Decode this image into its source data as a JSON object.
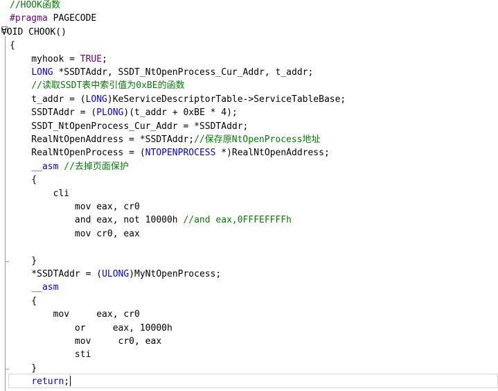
{
  "colors": {
    "comment": "#008000",
    "keyword": "#0000ff",
    "macro": "#6f008a",
    "text": "#000000",
    "background": "#ffffff"
  },
  "icons": {
    "fold": "collapse-minus-icon"
  },
  "lines": [
    [
      {
        "t": "//HOOK函数",
        "c": "comment"
      }
    ],
    [
      {
        "t": "#pragma",
        "c": "mac"
      },
      {
        "t": " PAGECODE",
        "c": "plain"
      }
    ],
    [
      {
        "t": "VOID CHOOK()",
        "c": "plain"
      }
    ],
    [
      {
        "t": "{",
        "c": "plain"
      }
    ],
    [
      {
        "t": "    myhook = ",
        "c": "plain"
      },
      {
        "t": "TRUE",
        "c": "mac"
      },
      {
        "t": ";",
        "c": "plain"
      }
    ],
    [
      {
        "t": "    ",
        "c": "plain"
      },
      {
        "t": "LONG",
        "c": "type"
      },
      {
        "t": " *SSDTAddr, SSDT_NtOpenProcess_Cur_Addr, t_addr;",
        "c": "plain"
      }
    ],
    [
      {
        "t": "    ",
        "c": "plain"
      },
      {
        "t": "//读取SSDT表中索引值为0xBE的函数",
        "c": "comment"
      }
    ],
    [
      {
        "t": "    t_addr = (",
        "c": "plain"
      },
      {
        "t": "LONG",
        "c": "type"
      },
      {
        "t": ")KeServiceDescriptorTable->ServiceTableBase;",
        "c": "plain"
      }
    ],
    [
      {
        "t": "    SSDTAddr = (",
        "c": "plain"
      },
      {
        "t": "PLONG",
        "c": "type"
      },
      {
        "t": ")(t_addr + 0xBE * 4);",
        "c": "plain"
      }
    ],
    [
      {
        "t": "    SSDT_NtOpenProcess_Cur_Addr = *SSDTAddr;",
        "c": "plain"
      }
    ],
    [
      {
        "t": "    RealNtOpenAddress = *SSDTAddr;",
        "c": "plain"
      },
      {
        "t": "//保存原NtOpenProcess地址",
        "c": "comment"
      }
    ],
    [
      {
        "t": "    RealNtOpenProcess = (",
        "c": "plain"
      },
      {
        "t": "NTOPENPROCESS",
        "c": "type"
      },
      {
        "t": " *)RealNtOpenAddress;",
        "c": "plain"
      }
    ],
    [
      {
        "t": "    ",
        "c": "plain"
      },
      {
        "t": "__asm",
        "c": "kw"
      },
      {
        "t": " ",
        "c": "plain"
      },
      {
        "t": "//去掉页面保护",
        "c": "comment"
      }
    ],
    [
      {
        "t": "    {",
        "c": "plain"
      }
    ],
    [
      {
        "t": "        cli",
        "c": "plain"
      }
    ],
    [
      {
        "t": "            mov eax, cr0",
        "c": "plain"
      }
    ],
    [
      {
        "t": "            and eax, not 10000h ",
        "c": "plain"
      },
      {
        "t": "//and eax,0FFFEFFFFh",
        "c": "comment"
      }
    ],
    [
      {
        "t": "            mov cr0, eax",
        "c": "plain"
      }
    ],
    [
      {
        "t": "",
        "c": "plain"
      }
    ],
    [
      {
        "t": "    }",
        "c": "plain"
      }
    ],
    [
      {
        "t": "    *SSDTAddr = (",
        "c": "plain"
      },
      {
        "t": "ULONG",
        "c": "type"
      },
      {
        "t": ")MyNtOpenProcess;",
        "c": "plain"
      }
    ],
    [
      {
        "t": "    ",
        "c": "plain"
      },
      {
        "t": "__asm",
        "c": "kw"
      }
    ],
    [
      {
        "t": "    {",
        "c": "plain"
      }
    ],
    [
      {
        "t": "        mov     eax, cr0",
        "c": "plain"
      }
    ],
    [
      {
        "t": "            or     eax, 10000h",
        "c": "plain"
      }
    ],
    [
      {
        "t": "            mov     cr0, eax",
        "c": "plain"
      }
    ],
    [
      {
        "t": "            sti",
        "c": "plain"
      }
    ],
    [
      {
        "t": "    }",
        "c": "plain"
      }
    ],
    [
      {
        "t": "    ",
        "c": "plain"
      },
      {
        "t": "return",
        "c": "kw"
      },
      {
        "t": ";",
        "c": "plain"
      }
    ]
  ]
}
